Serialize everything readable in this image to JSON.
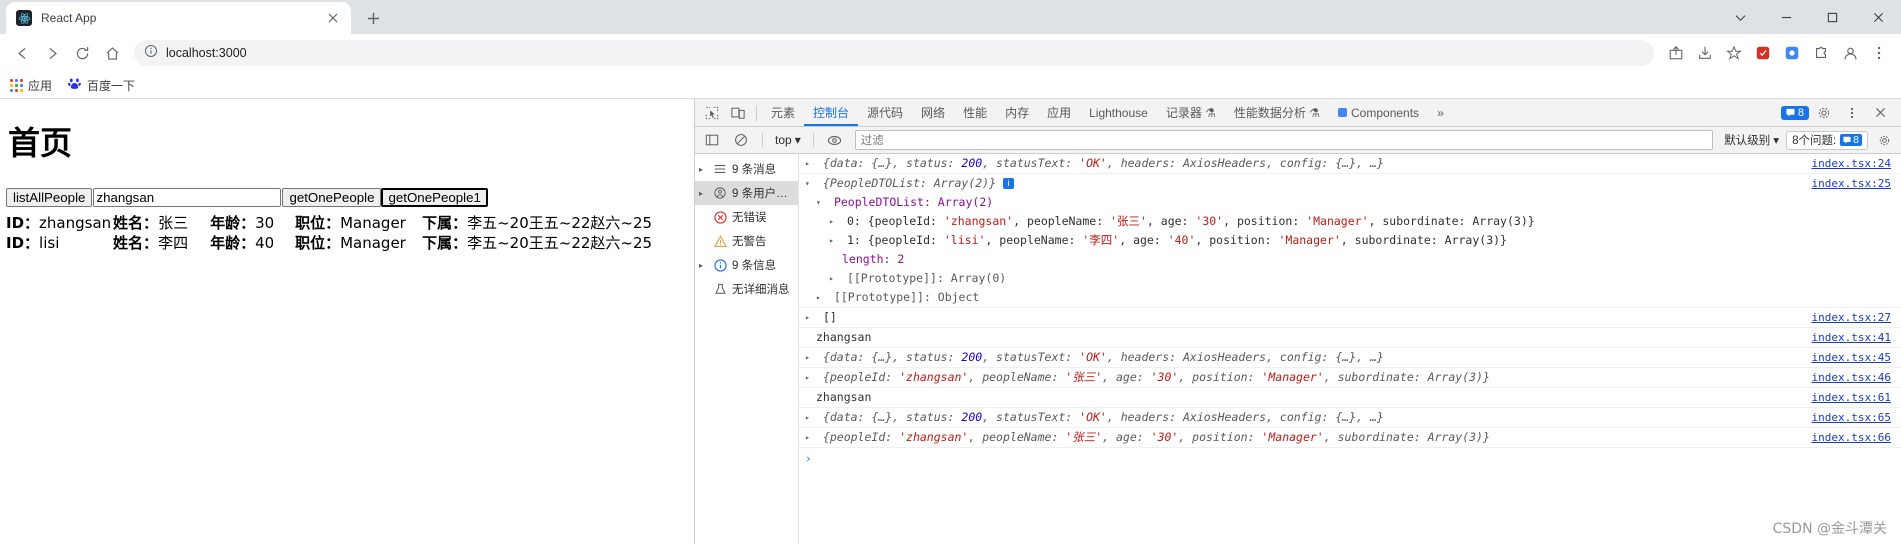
{
  "browser": {
    "tab": {
      "title": "React App",
      "favicon": "react-logo-icon",
      "close": "×"
    },
    "new_tab_label": "+",
    "window_controls": {
      "minimize": "—",
      "maximize": "□",
      "close": "×",
      "more": "⌄"
    },
    "nav": {
      "back": "←",
      "forward": "→",
      "reload": "⟳",
      "home": "⌂"
    },
    "omnibox": {
      "info_icon": "site-info-icon",
      "url": "localhost:3000"
    },
    "toolbar_right": {
      "avatar_initial": "",
      "menu": "⋮"
    },
    "bookmarks": [
      {
        "label": "应用",
        "icon": "apps-grid-icon"
      },
      {
        "label": "百度一下",
        "icon": "baidu-icon"
      }
    ]
  },
  "page": {
    "heading": "首页",
    "controls": {
      "list_all_button": "listAllPeople",
      "input_value": "zhangsan",
      "input_placeholder": "",
      "get_one_button": "getOnePeople",
      "get_one_button_1": "getOnePeople1"
    },
    "labels": {
      "id": "ID：",
      "name": "姓名：",
      "age": "年龄：",
      "position": "职位：",
      "subordinate": "下属："
    },
    "people": [
      {
        "id": "zhangsan",
        "name": "张三",
        "age": "30",
        "position": "Manager",
        "subordinate": "李五~20王五~22赵六~25"
      },
      {
        "id": "lisi",
        "name": "李四",
        "age": "40",
        "position": "Manager",
        "subordinate": "李五~20王五~22赵六~25"
      }
    ]
  },
  "devtools": {
    "left_icons": {
      "inspect": "inspect-element-icon",
      "device": "device-toolbar-icon"
    },
    "tabs": [
      {
        "label": "元素",
        "active": false
      },
      {
        "label": "控制台",
        "active": true
      },
      {
        "label": "源代码",
        "active": false
      },
      {
        "label": "网络",
        "active": false
      },
      {
        "label": "性能",
        "active": false
      },
      {
        "label": "内存",
        "active": false
      },
      {
        "label": "应用",
        "active": false
      },
      {
        "label": "Lighthouse",
        "active": false
      },
      {
        "label": "记录器 ⚗",
        "active": false
      },
      {
        "label": "性能数据分析 ⚗",
        "active": false
      },
      {
        "label": "Components",
        "active": false
      }
    ],
    "tabs_overflow": "»",
    "tab_badge": {
      "count": "8",
      "icon": "message-icon"
    },
    "settings_icon": "gear-icon",
    "more_icon": "kebab-menu-icon",
    "close_icon": "close-icon",
    "filterbar": {
      "sidebar_toggle_icon": "sidebar-toggle-icon",
      "clear_icon": "clear-console-icon",
      "context": "top",
      "context_caret": "▾",
      "eye_icon": "live-expression-icon",
      "filter_placeholder": "过滤",
      "level": "默认级别",
      "level_caret": "▾",
      "issues_label": "8个问题:",
      "issues_count": "8",
      "settings_icon": "console-settings-icon"
    },
    "sidebar": [
      {
        "label": "9 条消息",
        "icon": "messages-icon",
        "arrow": "▸",
        "selected": false
      },
      {
        "label": "9 条用户消…",
        "icon": "user-messages-icon",
        "arrow": "▸",
        "selected": true
      },
      {
        "label": "无错误",
        "icon": "error-icon",
        "arrow": "",
        "selected": false
      },
      {
        "label": "无警告",
        "icon": "warning-icon",
        "arrow": "",
        "selected": false
      },
      {
        "label": "9 条信息",
        "icon": "info-icon",
        "arrow": "▸",
        "selected": false
      },
      {
        "label": "无详细消息",
        "icon": "verbose-icon",
        "arrow": "",
        "selected": false
      }
    ],
    "logs": [
      {
        "kind": "object-preview",
        "arrow": "▸",
        "text": "{data: {…}, status: 200, statusText: 'OK', headers: AxiosHeaders, config: {…}, …}",
        "source": "index.tsx:24"
      },
      {
        "kind": "object-expanded",
        "arrow": "▾",
        "text": "{PeopleDTOList: Array(2)}",
        "info": "i",
        "source": "index.tsx:25"
      },
      {
        "kind": "child1",
        "arrow": "▾",
        "text": "PeopleDTOList: Array(2)",
        "source": ""
      },
      {
        "kind": "child2",
        "arrow": "▸",
        "text": "0: {peopleId: 'zhangsan', peopleName: '张三', age: '30', position: 'Manager', subordinate: Array(3)}",
        "source": ""
      },
      {
        "kind": "child2",
        "arrow": "▸",
        "text": "1: {peopleId: 'lisi', peopleName: '李四', age: '40', position: 'Manager', subordinate: Array(3)}",
        "source": ""
      },
      {
        "kind": "child2-plain",
        "arrow": "",
        "text": "length: 2",
        "source": ""
      },
      {
        "kind": "child2",
        "arrow": "▸",
        "text": "[[Prototype]]: Array(0)",
        "source": ""
      },
      {
        "kind": "child1",
        "arrow": "▸",
        "text": "[[Prototype]]: Object",
        "source": ""
      },
      {
        "kind": "object-preview",
        "arrow": "▸",
        "text": "[]",
        "source": "index.tsx:27"
      },
      {
        "kind": "plain",
        "arrow": "",
        "text": "zhangsan",
        "source": "index.tsx:41"
      },
      {
        "kind": "object-preview",
        "arrow": "▸",
        "text": "{data: {…}, status: 200, statusText: 'OK', headers: AxiosHeaders, config: {…}, …}",
        "source": "index.tsx:45"
      },
      {
        "kind": "object-preview",
        "arrow": "▸",
        "text": "{peopleId: 'zhangsan', peopleName: '张三', age: '30', position: 'Manager', subordinate: Array(3)}",
        "source": "index.tsx:46"
      },
      {
        "kind": "plain",
        "arrow": "",
        "text": "zhangsan",
        "source": "index.tsx:61"
      },
      {
        "kind": "object-preview",
        "arrow": "▸",
        "text": "{data: {…}, status: 200, statusText: 'OK', headers: AxiosHeaders, config: {…}, …}",
        "source": "index.tsx:65"
      },
      {
        "kind": "object-preview",
        "arrow": "▸",
        "text": "{peopleId: 'zhangsan', peopleName: '张三', age: '30', position: 'Manager', subordinate: Array(3)}",
        "source": "index.tsx:66"
      }
    ],
    "prompt_caret": "›"
  },
  "watermark": "CSDN @金斗潭关",
  "colors": {
    "accent": "#1a73e8",
    "string": "#c41a16",
    "number": "#1c00cf",
    "property": "#881391",
    "link": "#1a3acc",
    "chrome_bg": "#dee1e6"
  }
}
